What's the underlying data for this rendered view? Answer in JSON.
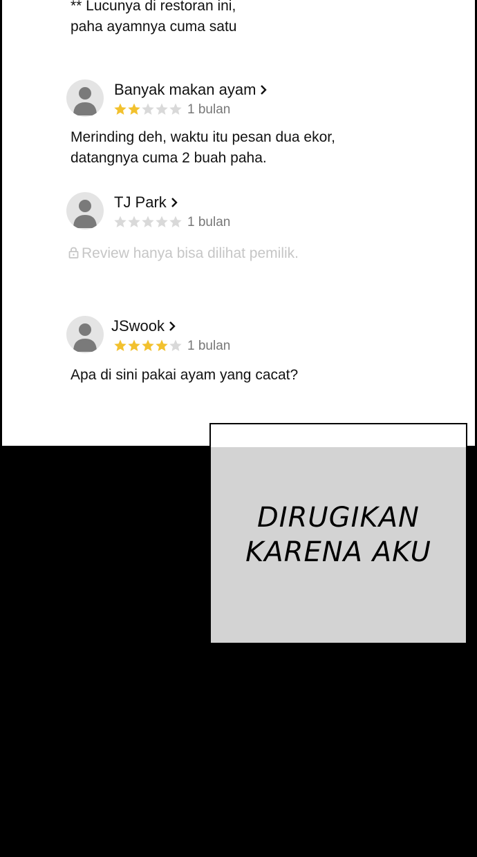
{
  "intro_lines": [
    "** Lucunya di restoran ini,",
    "paha ayamnya cuma satu"
  ],
  "reviews": [
    {
      "name": "Banyak makan ayam",
      "rating": 2,
      "max_rating": 5,
      "time": "1 bulan",
      "text_lines": [
        "Merinding deh, waktu itu pesan dua ekor,",
        "datangnya cuma 2 buah paha."
      ]
    },
    {
      "name": "TJ Park",
      "rating": 0,
      "max_rating": 5,
      "time": "1 bulan",
      "private_note": "Review hanya bisa dilihat pemilik."
    },
    {
      "name": "JSwook",
      "rating": 4,
      "max_rating": 5,
      "time": "1 bulan",
      "text_lines": [
        "Apa di sini pakai ayam yang cacat?"
      ]
    }
  ],
  "caption_lines": [
    "DIRUGIKAN",
    "KARENA AKU"
  ],
  "colors": {
    "star_filled": "#f2c12e",
    "star_empty": "#d9d9d9",
    "caption_box": "#d3d3d3"
  },
  "icons": {
    "avatar": "default-user-avatar-icon",
    "chevron": "chevron-right-icon",
    "lock": "lock-icon",
    "star": "star-icon"
  }
}
